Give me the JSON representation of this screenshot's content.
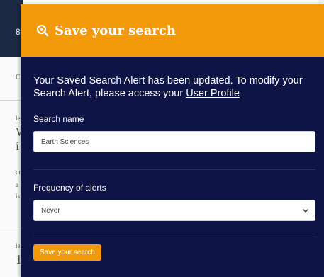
{
  "background": {
    "nav_digit": "8",
    "fragments": [
      "C",
      "le",
      "W",
      "i",
      "cr",
      "a",
      "is",
      "le",
      "1"
    ]
  },
  "modal": {
    "title": "Save your search",
    "message_text": "Your Saved Search Alert has been updated. To modify your Search Alert, please access your ",
    "message_link": "User Profile",
    "search_name": {
      "label": "Search name",
      "value": "Earth Sciences"
    },
    "frequency": {
      "label": "Frequency of alerts",
      "selected": "Never"
    },
    "save_button": "Save your search"
  },
  "colors": {
    "header": "#f39a0b",
    "modal_bg": "#0f1446",
    "button": "#f39a0b"
  },
  "icons": {
    "header_icon": "zoom-in-icon",
    "select_icon": "chevron-down-icon"
  }
}
